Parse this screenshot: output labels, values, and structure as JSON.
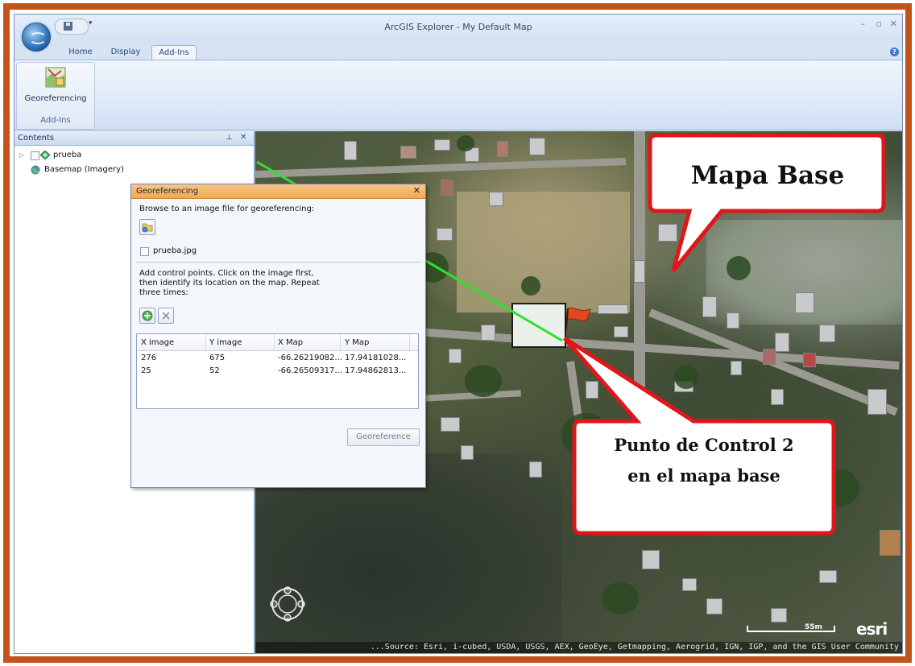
{
  "window": {
    "title": "ArcGIS Explorer - My Default Map",
    "controls": [
      "–",
      "▫",
      "✕"
    ]
  },
  "ribbon": {
    "tabs": [
      {
        "label": "Home"
      },
      {
        "label": "Display"
      },
      {
        "label": "Add-Ins",
        "active": true
      }
    ],
    "georef_label": "Georeferencing",
    "group_label": "Add-Ins"
  },
  "contents": {
    "title": "Contents",
    "layers": [
      {
        "label": "prueba"
      },
      {
        "label": "Basemap (Imagery)"
      }
    ]
  },
  "dialog": {
    "title": "Georeferencing",
    "browse_text": "Browse to an image file for georeferencing:",
    "file_label": "prueba.jpg",
    "instructions": [
      "Add control points. Click on the image first,",
      "then identify its location on the map. Repeat",
      "three times:"
    ],
    "columns": [
      "X image",
      "Y image",
      "X Map",
      "Y Map"
    ],
    "rows": [
      [
        "276",
        "675",
        "-66.26219082...",
        "17.94181028..."
      ],
      [
        "25",
        "52",
        "-66.26509317...",
        "17.94862813..."
      ]
    ],
    "georeference_button": "Georeference"
  },
  "map": {
    "scale_text": "55m",
    "logo_text": "esri",
    "attribution": "...Source: Esri, i-cubed, USDA, USGS, AEX, GeoEye, Getmapping, Aerogrid, IGN, IGP, and the GIS User Community"
  },
  "callouts": {
    "base_map": "Mapa Base",
    "control_point_line1": "Punto de Control 2",
    "control_point_line2": "en el mapa base"
  },
  "colors": {
    "frame": "#c2531a",
    "callout_border": "#e0161b",
    "control_line": "#2fe12f",
    "dialog_title": "#f2a94e"
  }
}
